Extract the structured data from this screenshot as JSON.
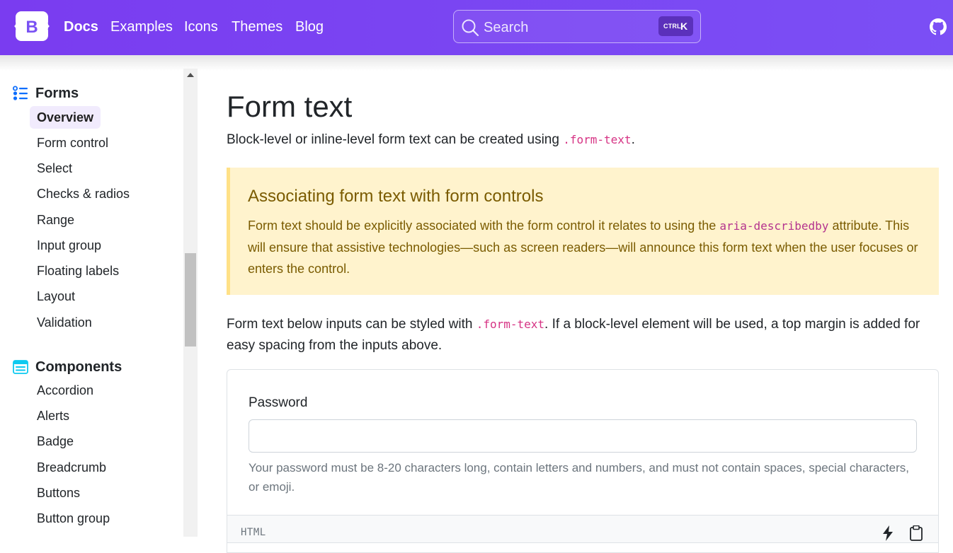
{
  "navbar": {
    "brand_letter": "B",
    "links": [
      "Docs",
      "Examples",
      "Icons",
      "Themes",
      "Blog"
    ],
    "search": {
      "placeholder": "Search",
      "kbd_ctrl": "CTRL",
      "kbd_key": "K"
    },
    "github_icon": "github-icon",
    "background": "#7952f3"
  },
  "sidebar": {
    "sections": [
      {
        "title": "Forms",
        "icon": "list-icon",
        "items": [
          "Overview",
          "Form control",
          "Select",
          "Checks & radios",
          "Range",
          "Input group",
          "Floating labels",
          "Layout",
          "Validation"
        ],
        "active": "Overview"
      },
      {
        "title": "Components",
        "icon": "components-icon",
        "items": [
          "Accordion",
          "Alerts",
          "Badge",
          "Breadcrumb",
          "Buttons",
          "Button group"
        ]
      }
    ]
  },
  "main": {
    "title": "Form text",
    "lead_before": "Block-level or inline-level form text can be created using ",
    "lead_code": ".form-text",
    "lead_after": ".",
    "callout": {
      "title": "Associating form text with form controls",
      "body_before": "Form text should be explicitly associated with the form control it relates to using the ",
      "body_code": "aria-describedby",
      "body_after": " attribute. This will ensure that assistive technologies—such as screen readers—will announce this form text when the user focuses or enters the control."
    },
    "paragraph_before": "Form text below inputs can be styled with ",
    "paragraph_code": ".form-text",
    "paragraph_after": ". If a block-level element will be used, a top margin is added for easy spacing from the inputs above.",
    "example": {
      "label": "Password",
      "input_value": "",
      "help": "Your password must be 8-20 characters long, contain letters and numbers, and must not contain spaces, special characters, or emoji."
    },
    "code_bar": {
      "lang": "HTML"
    }
  },
  "colors": {
    "accent": "#7952f3",
    "code": "#d63384",
    "callout_bg": "#fff3cd",
    "callout_text": "#7a5b00"
  }
}
